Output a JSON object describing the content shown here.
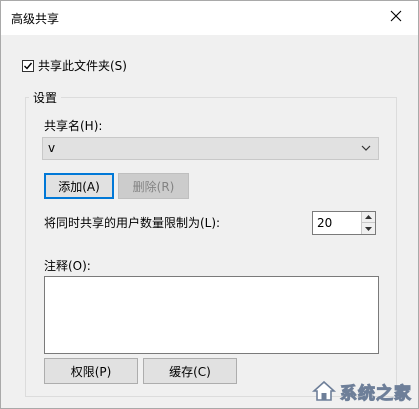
{
  "window": {
    "title": "高级共享"
  },
  "share_checkbox": {
    "label": "共享此文件夹(S)",
    "checked": true
  },
  "settings": {
    "group_label": "设置",
    "share_name_label": "共享名(H):",
    "share_name_value": "v",
    "add_button": "添加(A)",
    "remove_button": "删除(R)",
    "user_limit_label": "将同时共享的用户数量限制为(L):",
    "user_limit_value": "20",
    "comment_label": "注释(O):",
    "comment_value": "",
    "permissions_button": "权限(P)",
    "caching_button": "缓存(C)"
  },
  "watermark": {
    "text": "系统之家"
  },
  "colors": {
    "focus_border": "#0078d7",
    "dialog_bg": "#f0f0f0",
    "disabled_text": "#838383"
  }
}
